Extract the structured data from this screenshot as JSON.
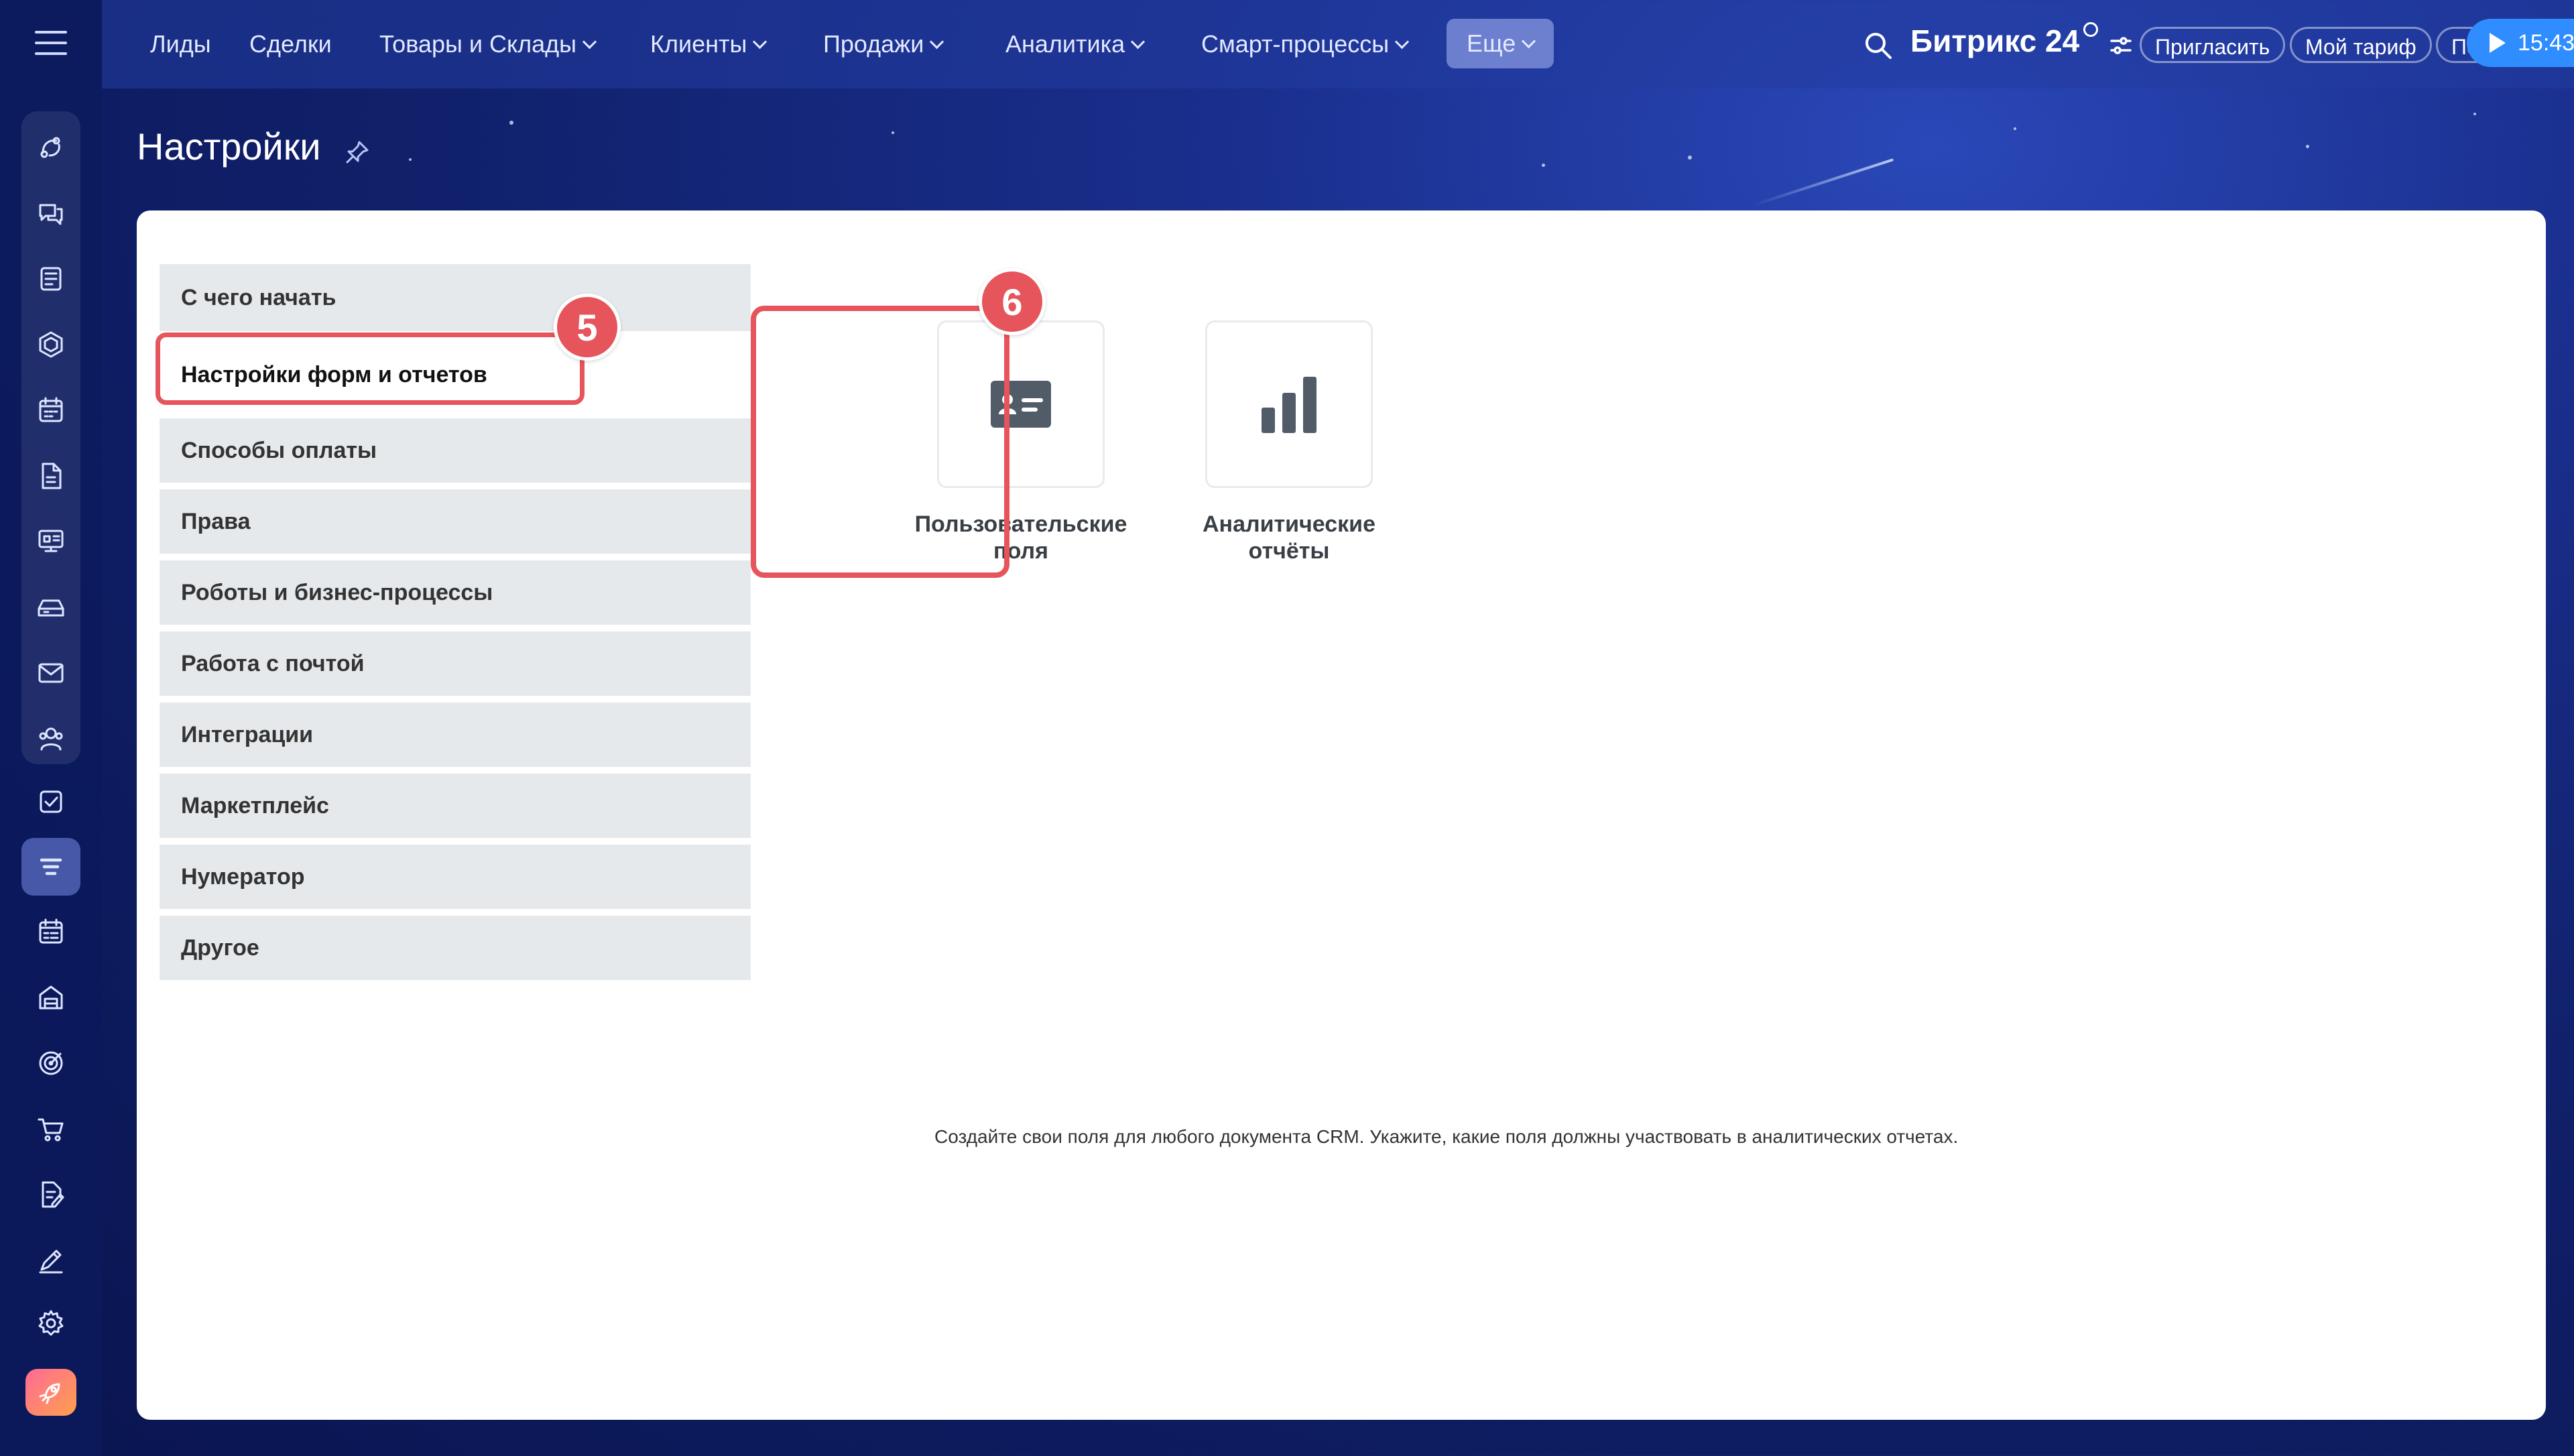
{
  "topbar": {
    "nav": [
      {
        "label": "Лиды",
        "has_dropdown": false
      },
      {
        "label": "Сделки",
        "has_dropdown": false
      },
      {
        "label": "Товары и Склады",
        "has_dropdown": true
      },
      {
        "label": "Клиенты",
        "has_dropdown": true
      },
      {
        "label": "Продажи",
        "has_dropdown": true
      },
      {
        "label": "Аналитика",
        "has_dropdown": true
      },
      {
        "label": "Смарт-процессы",
        "has_dropdown": true
      },
      {
        "label": "Еще",
        "has_dropdown": true
      }
    ],
    "brand": "Битрикс 24",
    "invite_label": "Пригласить",
    "tariff_label": "Мой тариф",
    "help_label": "Помощь",
    "time": "15:43"
  },
  "sidebar": {
    "icons": [
      "feed-icon",
      "chat-icon",
      "news-icon",
      "hexagon-icon",
      "calendar-icon",
      "document-icon",
      "board-icon",
      "drive-icon",
      "mail-icon",
      "contacts-icon",
      "tasks-icon",
      "crm-icon",
      "schedule-icon",
      "store-icon",
      "target-icon",
      "cart-icon",
      "sign-icon",
      "pen-icon",
      "gear-icon",
      "rocket-icon"
    ],
    "active": "crm-icon"
  },
  "page": {
    "title": "Настройки"
  },
  "settings_menu": {
    "items": [
      "С чего начать",
      "Настройки форм и отчетов",
      "Способы оплаты",
      "Права",
      "Роботы и бизнес-процессы",
      "Работа с почтой",
      "Интеграции",
      "Маркетплейс",
      "Нумератор",
      "Другое"
    ],
    "active_index": 1
  },
  "tiles": [
    {
      "label": "Пользовательские поля",
      "icon": "user-card-icon"
    },
    {
      "label": "Аналитические отчёты",
      "icon": "bar-chart-icon"
    }
  ],
  "annotations": {
    "step_a": "5",
    "step_b": "6",
    "color": "#e6545c"
  },
  "description": "Создайте свои поля для любого документа CRM. Укажите, какие поля должны участвовать в аналитических отчетах."
}
